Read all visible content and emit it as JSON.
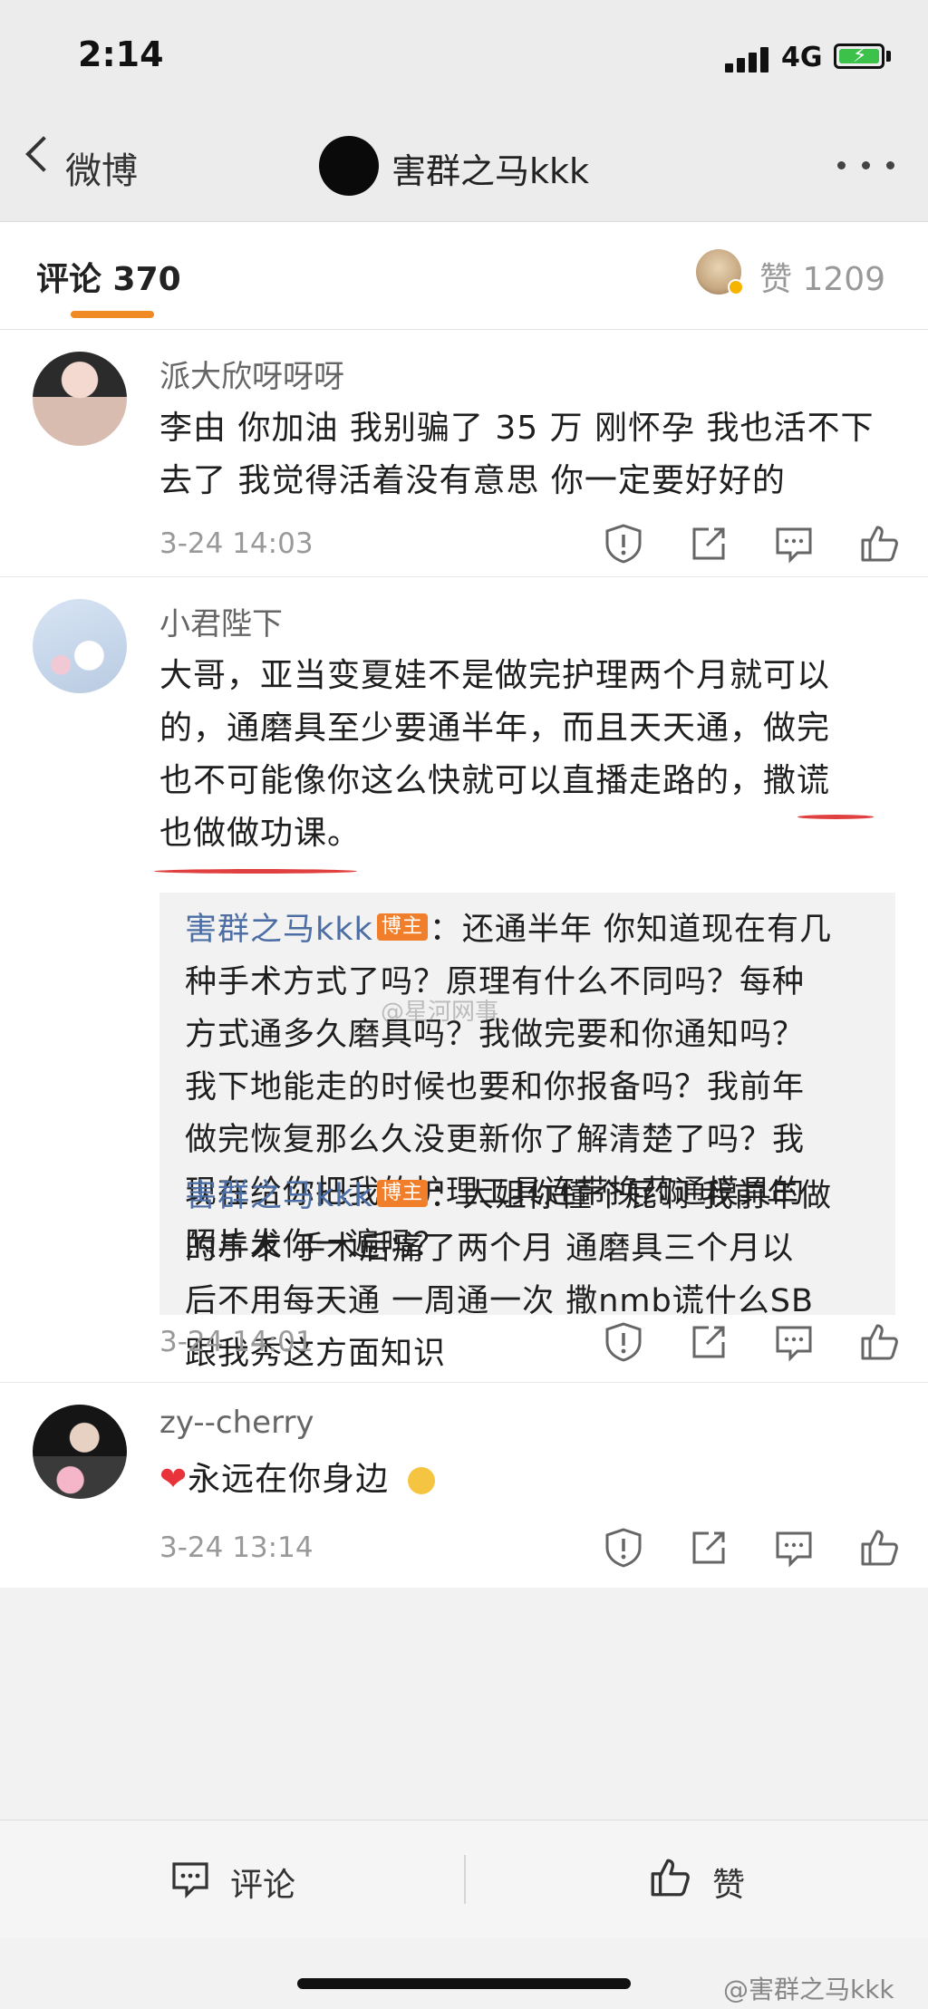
{
  "status_bar": {
    "time": "2:14",
    "network": "4G"
  },
  "header": {
    "back_label": "微博",
    "title": "害群之马kkk"
  },
  "tabs": {
    "comments_label": "评论 370",
    "likes_label": "赞 1209"
  },
  "comments": [
    {
      "username": "派大欣呀呀呀",
      "lines": [
        "李由 你加油 我别骗了 35 万 刚怀孕 我也活不下",
        "去了 我觉得活着没有意思 你一定要好好的"
      ],
      "time": "3-24 14:03"
    },
    {
      "username": "小君陛下",
      "lines": [
        "大哥，亚当变夏娃不是做完护理两个月就可以",
        "的，通磨具至少要通半年，而且天天通，做完",
        "也不可能像你这么快就可以直播走路的，撒谎",
        "也做做功课。"
      ],
      "time": "3-24 14:01",
      "replies": [
        {
          "user": "害群之马kkk",
          "badge": "博主",
          "first": "：还通半年 你知道现在有几",
          "lines": [
            "种手术方式了吗？原理有什么不同吗？每种",
            "方式通多久磨具吗？我做完要和你通知吗？",
            "我下地能走的时候也要和你报备吗？我前年",
            "做完恢复那么久没更新你了解清楚了吗？我",
            "现在给你把我的护理工具连带换药通模具的",
            "照片发你一遍吗？"
          ]
        },
        {
          "user": "害群之马kkk",
          "badge": "博主",
          "first": "：大姐你懂个屁啊 我前年做",
          "lines": [
            "的手术 手术后痛了两个月 通磨具三个月以",
            "后不用每天通 一周通一次 撒nmb谎什么SB",
            "跟我秀这方面知识"
          ]
        }
      ]
    },
    {
      "username": "zy--cherry",
      "text": "永远在你身边",
      "time": "3-24 13:14"
    }
  ],
  "bottom_bar": {
    "comment_label": "评论",
    "like_label": "赞"
  },
  "watermarks": {
    "middle": "@星河网事",
    "bottom": "@害群之马kkk"
  },
  "colors": {
    "accent": "#f08a24",
    "link": "#4c6ea4",
    "badge": "#f07e2a",
    "annotation": "#e0403f"
  }
}
